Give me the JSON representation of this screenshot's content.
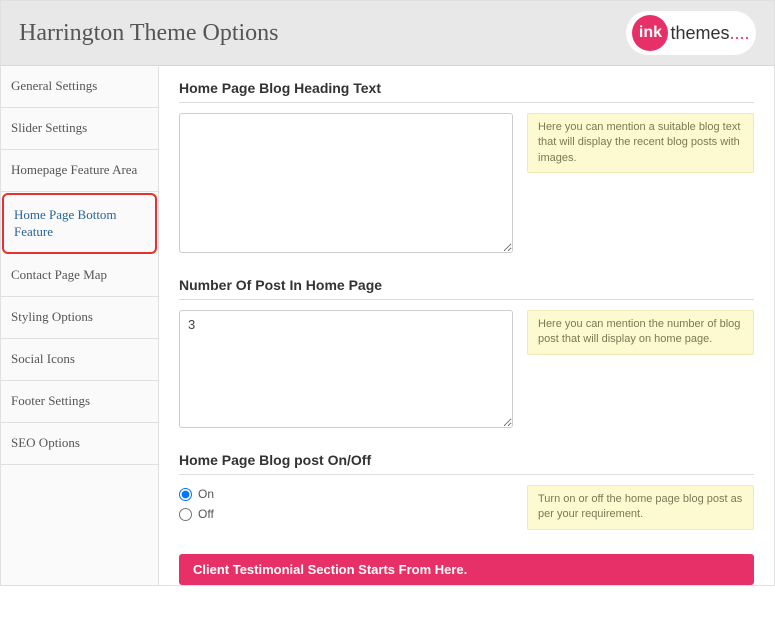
{
  "header": {
    "title": "Harrington Theme Options"
  },
  "logo": {
    "circle_text": "ink",
    "rest_text": "themes"
  },
  "sidebar": {
    "items": [
      {
        "label": "General Settings",
        "active": false
      },
      {
        "label": "Slider Settings",
        "active": false
      },
      {
        "label": "Homepage Feature Area",
        "active": false
      },
      {
        "label": "Home Page Bottom Feature",
        "active": true
      },
      {
        "label": "Contact Page Map",
        "active": false
      },
      {
        "label": "Styling Options",
        "active": false
      },
      {
        "label": "Social Icons",
        "active": false
      },
      {
        "label": "Footer Settings",
        "active": false
      },
      {
        "label": "SEO Options",
        "active": false
      }
    ]
  },
  "sections": {
    "blog_heading": {
      "title": "Home Page Blog Heading Text",
      "value": "",
      "help": "Here you can mention a suitable blog text that will display the recent blog posts with images."
    },
    "num_posts": {
      "title": "Number Of Post In Home Page",
      "value": "3",
      "help": "Here you can mention the number of blog post that will display on home page."
    },
    "blog_onoff": {
      "title": "Home Page Blog post On/Off",
      "options": {
        "on": "On",
        "off": "Off"
      },
      "selected": "on",
      "help": "Turn on or off the home page blog post as per your requirement."
    }
  },
  "banner": {
    "text": "Client Testimonial Section Starts From Here."
  }
}
